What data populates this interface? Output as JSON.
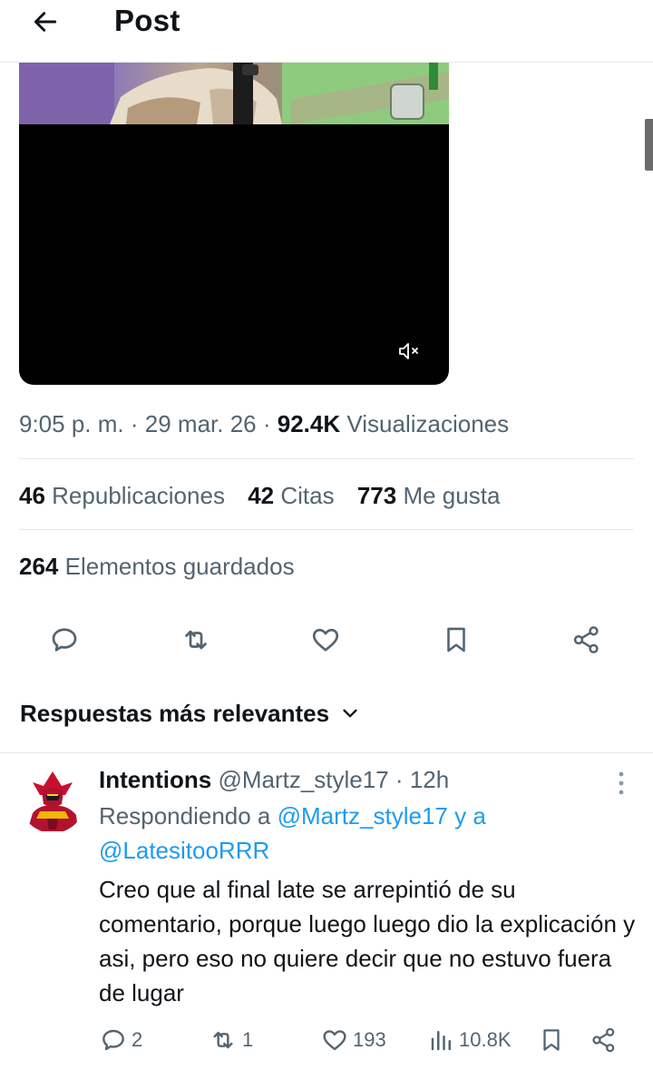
{
  "header": {
    "title": "Post"
  },
  "post": {
    "time": "9:05 p. m.",
    "separator": "·",
    "date": "29 mar. 26",
    "views_count": "92.4K",
    "views_label": "Visualizaciones",
    "stats": [
      {
        "count": "46",
        "label": "Republicaciones"
      },
      {
        "count": "42",
        "label": "Citas"
      },
      {
        "count": "773",
        "label": "Me gusta"
      }
    ],
    "saved": {
      "count": "264",
      "label": "Elementos guardados"
    },
    "actions": [
      {
        "icon": "reply-icon"
      },
      {
        "icon": "repost-icon"
      },
      {
        "icon": "like-icon"
      },
      {
        "icon": "bookmark-icon"
      },
      {
        "icon": "share-icon"
      }
    ],
    "media": {
      "mute_icon": "mute-icon"
    }
  },
  "replies_sort": {
    "label": "Respuestas más relevantes",
    "icon": "chevron-down-icon"
  },
  "reply": {
    "name": "Intentions",
    "handle": "@Martz_style17",
    "separator": "·",
    "time": "12h",
    "replying_prefix": "Respondiendo a",
    "replying_handle_1": "@Martz_style17",
    "replying_join": "y a",
    "replying_handle_2": "@LatesitooRRR",
    "text": "Creo que al final late se arrepintió de su comentario, porque luego luego dio la explicación y asi, pero eso no quiere decir que no estuvo fuera de lugar",
    "actions": {
      "replies": "2",
      "reposts": "1",
      "likes": "193",
      "views": "10.8K"
    }
  },
  "colors": {
    "text_primary": "#0f1419",
    "text_secondary": "#536471",
    "link": "#1d9bf0",
    "divider": "#e6e9ec"
  }
}
